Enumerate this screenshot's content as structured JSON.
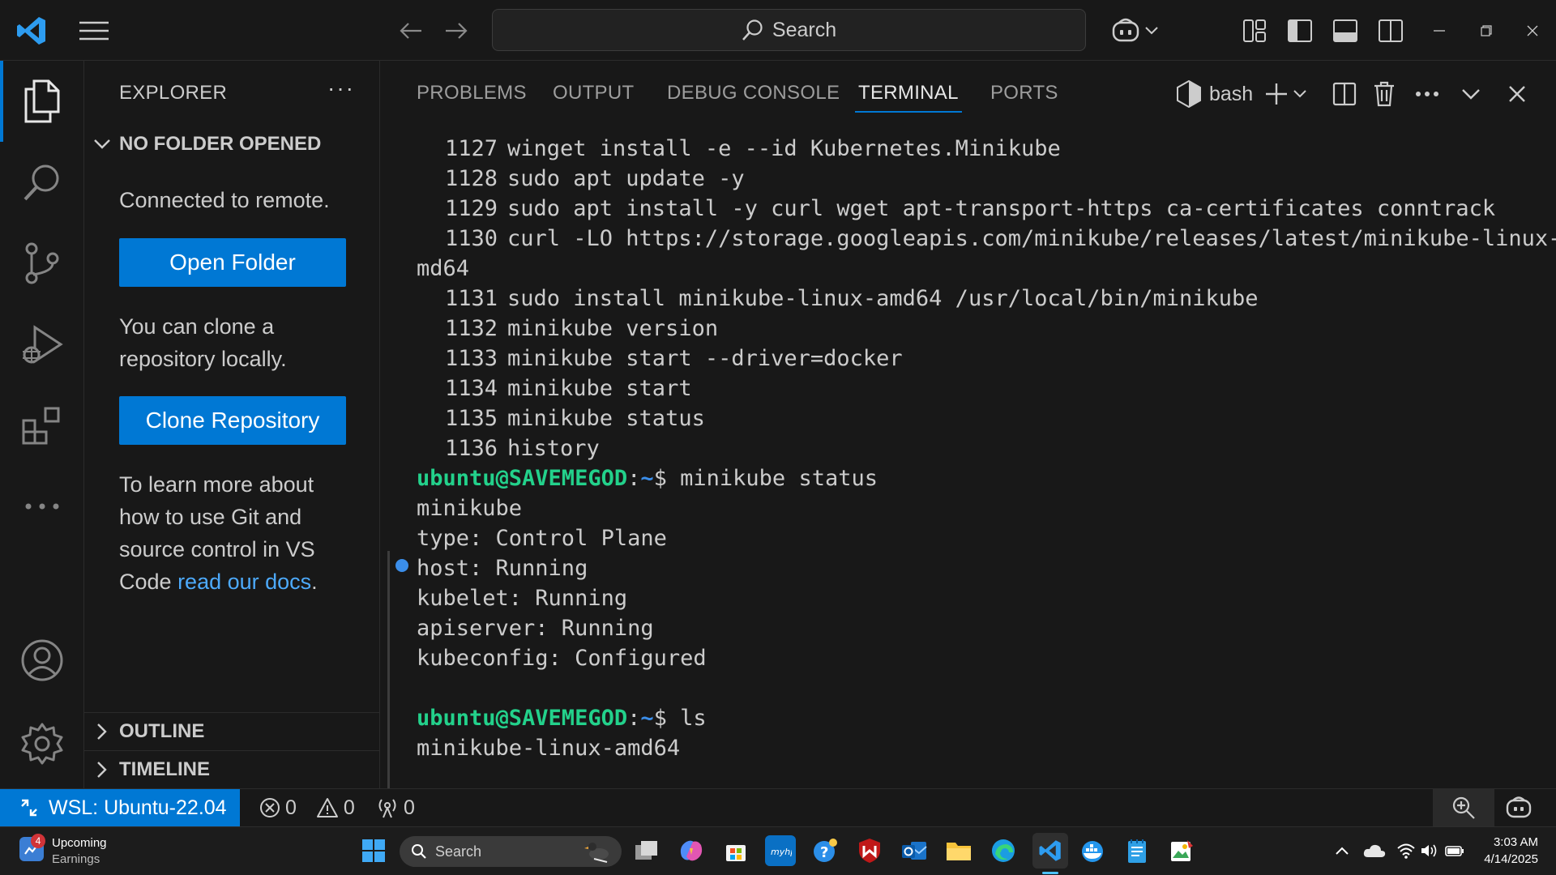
{
  "titlebar": {
    "search_placeholder": "Search"
  },
  "sidebar": {
    "title": "EXPLORER",
    "more": "···",
    "section_no_folder": "NO FOLDER OPENED",
    "connected_text": "Connected to remote.",
    "open_folder_label": "Open Folder",
    "clone_text": "You can clone a repository locally.",
    "clone_button_label": "Clone Repository",
    "learn_text": "To learn more about how to use Git and source control in VS Code ",
    "learn_link": "read our docs",
    "learn_end": ".",
    "section_outline": "OUTLINE",
    "section_timeline": "TIMELINE"
  },
  "panel": {
    "tabs": [
      {
        "label": "PROBLEMS"
      },
      {
        "label": "OUTPUT"
      },
      {
        "label": "DEBUG CONSOLE"
      },
      {
        "label": "TERMINAL"
      },
      {
        "label": "PORTS"
      }
    ],
    "shell_label": "bash"
  },
  "terminal": {
    "history": [
      {
        "num": "1127",
        "cmd": "winget install -e --id Kubernetes.Minikube"
      },
      {
        "num": "1128",
        "cmd": "sudo apt update -y"
      },
      {
        "num": "1129",
        "cmd": "sudo apt install -y curl wget apt-transport-https ca-certificates conntrack"
      },
      {
        "num": "1130",
        "cmd": "curl -LO https://storage.googleapis.com/minikube/releases/latest/minikube-linux-a"
      },
      {
        "num": "",
        "cmd": "md64"
      },
      {
        "num": "1131",
        "cmd": "sudo install minikube-linux-amd64 /usr/local/bin/minikube"
      },
      {
        "num": "1132",
        "cmd": "minikube version"
      },
      {
        "num": "1133",
        "cmd": "minikube start --driver=docker"
      },
      {
        "num": "1134",
        "cmd": "minikube start"
      },
      {
        "num": "1135",
        "cmd": "minikube status"
      },
      {
        "num": "1136",
        "cmd": "history"
      }
    ],
    "prompt1": {
      "user": "ubuntu@SAVEMEGOD",
      "colon": ":",
      "path": "~",
      "dollar": "$ ",
      "cmd": "minikube status"
    },
    "output1": [
      "minikube",
      "type: Control Plane",
      "host: Running",
      "kubelet: Running",
      "apiserver: Running",
      "kubeconfig: Configured"
    ],
    "prompt2": {
      "user": "ubuntu@SAVEMEGOD",
      "colon": ":",
      "path": "~",
      "dollar": "$ ",
      "cmd": "ls"
    },
    "output2": [
      "minikube-linux-amd64"
    ]
  },
  "statusbar": {
    "remote_label": "WSL: Ubuntu-22.04",
    "errors": "0",
    "warnings": "0",
    "ports": "0"
  },
  "taskbar": {
    "widget_badge": "4",
    "widget_title": "Upcoming",
    "widget_subtitle": "Earnings",
    "search_placeholder": "Search",
    "time": "3:03 AM",
    "date": "4/14/2025"
  },
  "colors": {
    "accent": "#0078d4",
    "prompt_user": "#23d18b",
    "prompt_path": "#3b8eea",
    "link": "#4daafc"
  }
}
